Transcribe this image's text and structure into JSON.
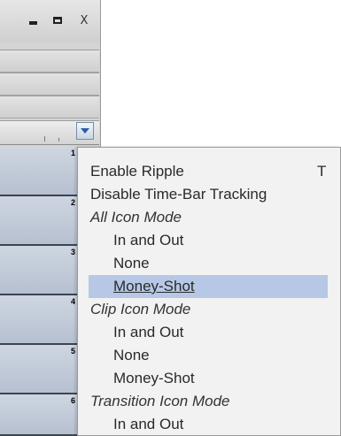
{
  "window": {
    "controls": {
      "minimize_icon": "minimize-icon",
      "maximize_icon": "maximize-icon",
      "close_label": "X"
    }
  },
  "tracks": [
    {
      "number": "1"
    },
    {
      "number": "2"
    },
    {
      "number": "3"
    },
    {
      "number": "4"
    },
    {
      "number": "5"
    },
    {
      "number": "6"
    }
  ],
  "menu": {
    "items": [
      {
        "label": "Enable Ripple",
        "shortcut": "T"
      },
      {
        "label": "Disable Time-Bar Tracking"
      },
      {
        "label": "All Icon Mode",
        "group": true
      },
      {
        "label": "In and Out"
      },
      {
        "label": "None"
      },
      {
        "label": "Money-Shot",
        "highlighted": true
      },
      {
        "label": "Clip Icon Mode",
        "group": true
      },
      {
        "label": "In and Out"
      },
      {
        "label": "None"
      },
      {
        "label": "Money-Shot"
      },
      {
        "label": "Transition Icon Mode",
        "group": true
      },
      {
        "label": "In and Out"
      }
    ],
    "highlight_color": "#b6c8e6"
  }
}
